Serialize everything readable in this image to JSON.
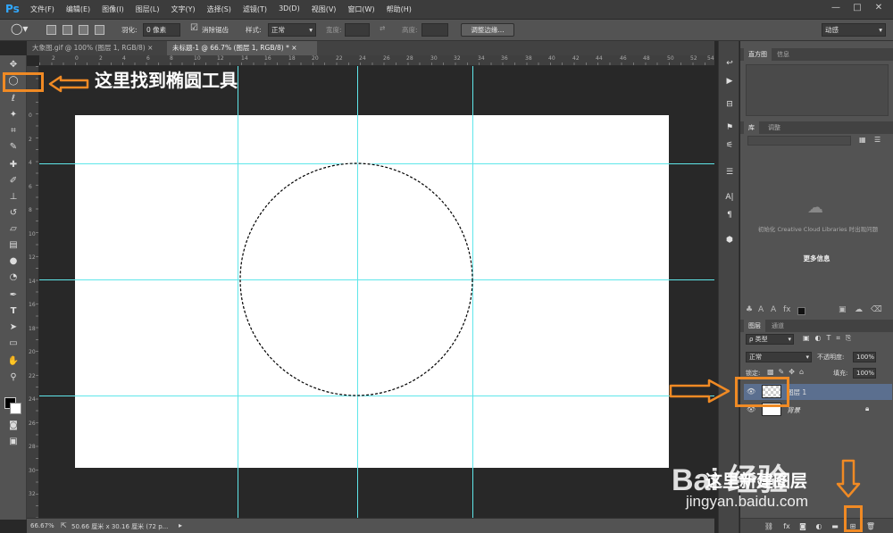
{
  "app": {
    "logo": "Ps"
  },
  "menu": [
    "文件(F)",
    "编辑(E)",
    "图像(I)",
    "图层(L)",
    "文字(Y)",
    "选择(S)",
    "滤镜(T)",
    "3D(D)",
    "视图(V)",
    "窗口(W)",
    "帮助(H)"
  ],
  "window_controls": [
    "—",
    "□",
    "✕"
  ],
  "options_bar": {
    "feather_label": "羽化:",
    "feather_value": "0 像素",
    "antialias_label": "消除锯齿",
    "style_label": "样式:",
    "style_value": "正常",
    "width_label": "宽度:",
    "height_label": "高度:",
    "refine_button": "调整边缘...",
    "workspace": "动感"
  },
  "tabs": [
    {
      "label": "大象图.gif @ 100% (图层 1, RGB/8)",
      "close": "×"
    },
    {
      "label": "未标题-1 @ 66.7% (图层 1, RGB/8) *",
      "close": "×"
    }
  ],
  "ruler_h_labels": [
    "2",
    "0",
    "2",
    "4",
    "6",
    "8",
    "10",
    "12",
    "14",
    "16",
    "18",
    "20",
    "22",
    "24",
    "26",
    "28",
    "30",
    "32",
    "34",
    "36",
    "38",
    "40",
    "42",
    "44",
    "46",
    "48",
    "50",
    "52",
    "54"
  ],
  "ruler_v_labels": [
    "0",
    "2",
    "4",
    "6",
    "8",
    "10",
    "12",
    "14",
    "16",
    "18",
    "20",
    "22",
    "24",
    "26",
    "28",
    "30",
    "32"
  ],
  "status": {
    "zoom": "66.67%",
    "doc_info": "50.66 厘米 x 30.16 厘米 (72 p..."
  },
  "panels": {
    "histogram_tabs": [
      "直方图",
      "信息"
    ],
    "library_tabs": [
      "库",
      "调整"
    ],
    "library_message": "初始化 Creative Cloud Libraries 时出现问题",
    "more_info": "更多信息",
    "layers_tabs": [
      "图层",
      "通道"
    ],
    "kind_filter": "ρ 类型",
    "blend_mode": "正常",
    "opacity_label": "不透明度:",
    "opacity_value": "100%",
    "lock_label": "锁定:",
    "fill_label": "填充:",
    "fill_value": "100%",
    "layers": [
      {
        "name": "图层 1",
        "selected": true
      },
      {
        "name": "背景",
        "selected": false,
        "locked": true
      }
    ]
  },
  "annotations": {
    "ellipse_tool_note": "这里找到椭圆工具",
    "new_layer_note": "这里新建图层"
  },
  "watermark": {
    "brand": "Bai 经验",
    "url": "jingyan.baidu.com"
  },
  "colors": {
    "accent_orange": "#f08a24",
    "guide_cyan": "#5fe6ea",
    "selected_layer": "#5b6f8f"
  }
}
